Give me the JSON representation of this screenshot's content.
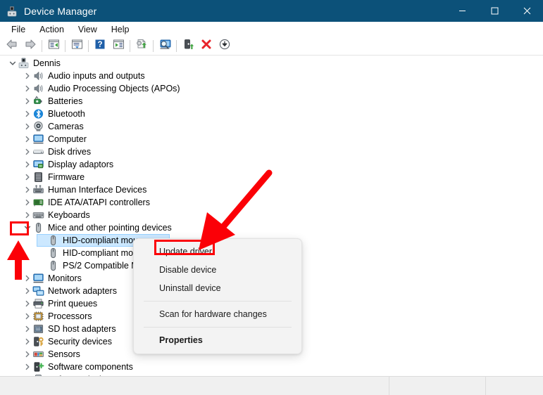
{
  "window": {
    "title": "Device Manager",
    "icon": "device-manager-icon",
    "titlebar_color": "#0c5179",
    "minimize_label": "Minimize",
    "maximize_label": "Maximize",
    "close_label": "Close"
  },
  "menubar": {
    "items": [
      {
        "label": "File",
        "name": "menu-file"
      },
      {
        "label": "Action",
        "name": "menu-action"
      },
      {
        "label": "View",
        "name": "menu-view"
      },
      {
        "label": "Help",
        "name": "menu-help"
      }
    ]
  },
  "toolbar": {
    "buttons": [
      {
        "icon": "back-arrow-icon",
        "name": "toolbar-back"
      },
      {
        "icon": "forward-arrow-icon",
        "name": "toolbar-forward"
      },
      {
        "icon": "up-one-level-icon",
        "name": "toolbar-up-level"
      },
      {
        "icon": "properties-icon",
        "name": "toolbar-properties"
      },
      {
        "icon": "help-icon",
        "name": "toolbar-help"
      },
      {
        "icon": "show-hide-console-tree-icon",
        "name": "toolbar-show-hide-tree"
      },
      {
        "icon": "update-driver-icon",
        "name": "toolbar-update-driver"
      },
      {
        "icon": "scan-for-hardware-changes-icon",
        "name": "toolbar-scan-hardware"
      },
      {
        "icon": "enable-device-icon",
        "name": "toolbar-enable-device"
      },
      {
        "icon": "uninstall-device-icon",
        "name": "toolbar-uninstall-device"
      },
      {
        "icon": "download-icon",
        "name": "toolbar-download"
      }
    ]
  },
  "tree": {
    "root": {
      "label": "Dennis",
      "icon": "computer-icon",
      "expanded": true
    },
    "items": [
      {
        "label": "Audio inputs and outputs",
        "icon": "speaker-icon",
        "indent": 1,
        "chevron": "collapsed"
      },
      {
        "label": "Audio Processing Objects (APOs)",
        "icon": "speaker-icon",
        "indent": 1,
        "chevron": "collapsed"
      },
      {
        "label": "Batteries",
        "icon": "battery-icon",
        "indent": 1,
        "chevron": "collapsed"
      },
      {
        "label": "Bluetooth",
        "icon": "bluetooth-icon",
        "indent": 1,
        "chevron": "collapsed"
      },
      {
        "label": "Cameras",
        "icon": "camera-icon",
        "indent": 1,
        "chevron": "collapsed"
      },
      {
        "label": "Computer",
        "icon": "monitor-icon",
        "indent": 1,
        "chevron": "collapsed"
      },
      {
        "label": "Disk drives",
        "icon": "disk-icon",
        "indent": 1,
        "chevron": "collapsed"
      },
      {
        "label": "Display adaptors",
        "icon": "display-adapter-icon",
        "indent": 1,
        "chevron": "collapsed"
      },
      {
        "label": "Firmware",
        "icon": "firmware-icon",
        "indent": 1,
        "chevron": "collapsed"
      },
      {
        "label": "Human Interface Devices",
        "icon": "hid-icon",
        "indent": 1,
        "chevron": "collapsed"
      },
      {
        "label": "IDE ATA/ATAPI controllers",
        "icon": "ide-controller-icon",
        "indent": 1,
        "chevron": "collapsed"
      },
      {
        "label": "Keyboards",
        "icon": "keyboard-icon",
        "indent": 1,
        "chevron": "collapsed"
      },
      {
        "label": "Mice and other pointing devices",
        "icon": "mouse-icon",
        "indent": 1,
        "chevron": "expanded"
      },
      {
        "label": "HID-compliant mouse",
        "icon": "mouse-icon",
        "indent": 2,
        "chevron": "none",
        "selected": true
      },
      {
        "label": "HID-compliant mouse",
        "icon": "mouse-icon",
        "indent": 2,
        "chevron": "none"
      },
      {
        "label": "PS/2 Compatible Mouse",
        "icon": "mouse-icon",
        "indent": 2,
        "chevron": "none"
      },
      {
        "label": "Monitors",
        "icon": "monitor-icon",
        "indent": 1,
        "chevron": "collapsed"
      },
      {
        "label": "Network adapters",
        "icon": "network-icon",
        "indent": 1,
        "chevron": "collapsed"
      },
      {
        "label": "Print queues",
        "icon": "printer-icon",
        "indent": 1,
        "chevron": "collapsed"
      },
      {
        "label": "Processors",
        "icon": "processor-icon",
        "indent": 1,
        "chevron": "collapsed"
      },
      {
        "label": "SD host adapters",
        "icon": "sd-adapter-icon",
        "indent": 1,
        "chevron": "collapsed"
      },
      {
        "label": "Security devices",
        "icon": "security-icon",
        "indent": 1,
        "chevron": "collapsed"
      },
      {
        "label": "Sensors",
        "icon": "sensor-icon",
        "indent": 1,
        "chevron": "collapsed"
      },
      {
        "label": "Software components",
        "icon": "software-component-icon",
        "indent": 1,
        "chevron": "collapsed"
      },
      {
        "label": "Software devices",
        "icon": "software-device-icon",
        "indent": 1,
        "chevron": "collapsed"
      }
    ]
  },
  "context_menu": {
    "items": [
      {
        "label": "Update driver",
        "name": "ctx-update-driver",
        "highlighted": true
      },
      {
        "label": "Disable device",
        "name": "ctx-disable-device"
      },
      {
        "label": "Uninstall device",
        "name": "ctx-uninstall-device"
      },
      {
        "separator": true
      },
      {
        "label": "Scan for hardware changes",
        "name": "ctx-scan-hardware-changes"
      },
      {
        "separator": true
      },
      {
        "label": "Properties",
        "name": "ctx-properties",
        "bold": true
      }
    ]
  },
  "annotations": {
    "color": "#fb0007",
    "highlight_update_driver": "Update driver",
    "highlight_expand_chevron": "Mice and other pointing devices expand chevron"
  },
  "statusbar": {
    "segment1": "",
    "segment2": "",
    "segment3": ""
  }
}
